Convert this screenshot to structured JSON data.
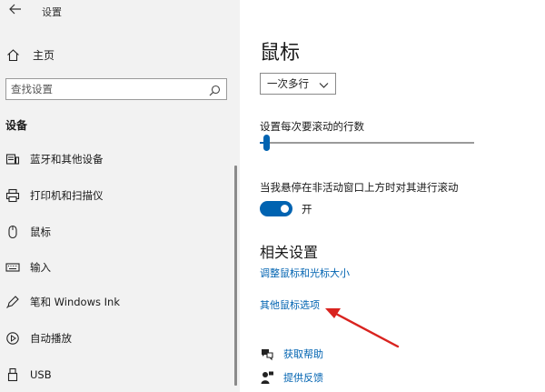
{
  "app": {
    "title": "设置",
    "back_icon": "back-arrow-icon"
  },
  "sidebar": {
    "home_label": "主页",
    "search_placeholder": "查找设置",
    "section_title": "设备",
    "items": [
      {
        "label": "蓝牙和其他设备",
        "icon": "bluetooth-devices-icon"
      },
      {
        "label": "打印机和扫描仪",
        "icon": "printer-icon"
      },
      {
        "label": "鼠标",
        "icon": "mouse-icon"
      },
      {
        "label": "输入",
        "icon": "keyboard-icon"
      },
      {
        "label": "笔和 Windows Ink",
        "icon": "pen-icon"
      },
      {
        "label": "自动播放",
        "icon": "autoplay-icon"
      },
      {
        "label": "USB",
        "icon": "usb-icon"
      }
    ]
  },
  "main": {
    "title": "鼠标",
    "scroll_mode_value": "一次多行",
    "lines_label": "设置每次要滚动的行数",
    "lines_slider_fraction": 0.03,
    "inactive_scroll_label": "当我悬停在非活动窗口上方时对其进行滚动",
    "inactive_scroll_state": "开",
    "related_title": "相关设置",
    "links": [
      "调整鼠标和光标大小",
      "其他鼠标选项"
    ],
    "help_links": [
      {
        "label": "获取帮助",
        "icon": "help-chat-icon"
      },
      {
        "label": "提供反馈",
        "icon": "feedback-icon"
      }
    ]
  },
  "colors": {
    "accent": "#0063b1",
    "sidebar_bg": "#f2f2f2",
    "annotation_arrow": "#d9231f"
  }
}
